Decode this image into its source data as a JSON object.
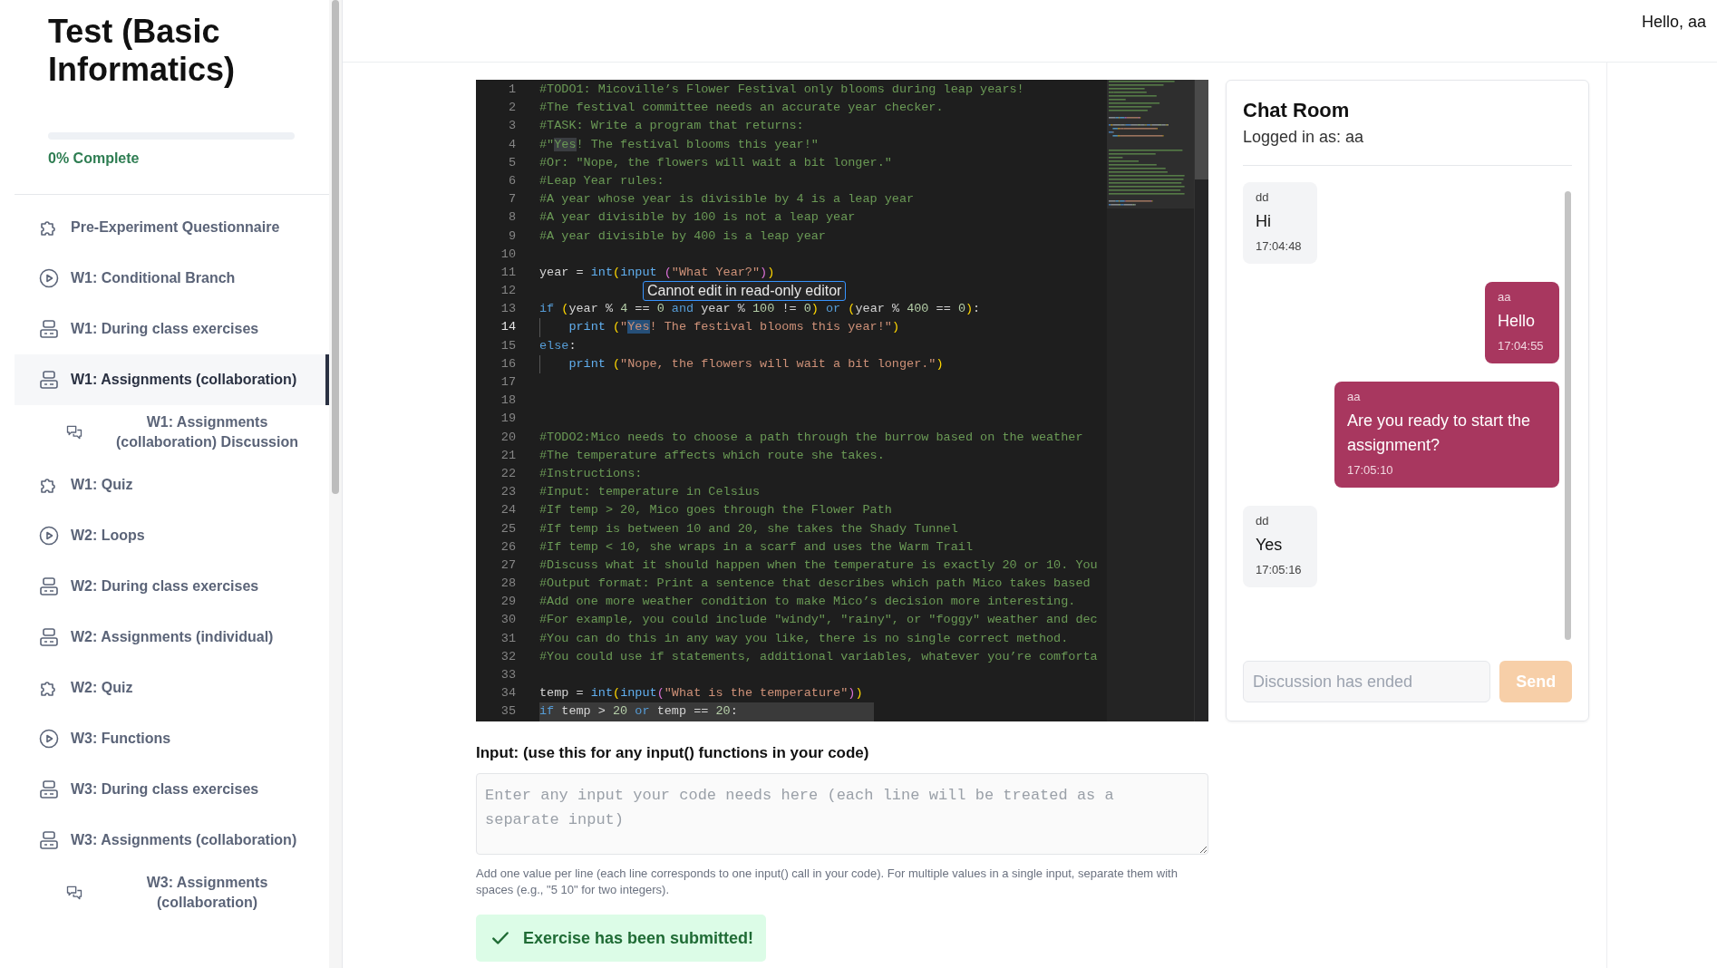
{
  "sidebar": {
    "course_title": "Test (Basic Informatics)",
    "progress": {
      "level": 0,
      "label": "0% Complete"
    },
    "items": [
      {
        "label": "Pre-Experiment Questionnaire",
        "kind": "quiz",
        "selected": false,
        "sub": false
      },
      {
        "label": "W1: Conditional Branch",
        "kind": "video",
        "selected": false,
        "sub": false
      },
      {
        "label": "W1: During class exercises",
        "kind": "exercise",
        "selected": false,
        "sub": false
      },
      {
        "label": "W1: Assignments (collaboration)",
        "kind": "exercise",
        "selected": true,
        "sub": false
      },
      {
        "label": "W1: Assignments (collaboration) Discussion",
        "kind": "discussion",
        "selected": false,
        "sub": true
      },
      {
        "label": "W1: Quiz",
        "kind": "quiz",
        "selected": false,
        "sub": false
      },
      {
        "label": "W2: Loops",
        "kind": "video",
        "selected": false,
        "sub": false
      },
      {
        "label": "W2: During class exercises",
        "kind": "exercise",
        "selected": false,
        "sub": false
      },
      {
        "label": "W2: Assignments (individual)",
        "kind": "exercise",
        "selected": false,
        "sub": false
      },
      {
        "label": "W2: Quiz",
        "kind": "quiz",
        "selected": false,
        "sub": false
      },
      {
        "label": "W3: Functions",
        "kind": "video",
        "selected": false,
        "sub": false
      },
      {
        "label": "W3: During class exercises",
        "kind": "exercise",
        "selected": false,
        "sub": false
      },
      {
        "label": "W3: Assignments (collaboration)",
        "kind": "exercise",
        "selected": false,
        "sub": false
      },
      {
        "label": "W3: Assignments (collaboration)",
        "kind": "discussion",
        "selected": false,
        "sub": true
      }
    ]
  },
  "header": {
    "greeting": "Hello, aa"
  },
  "editor": {
    "lines": [
      {
        "n": "1",
        "current": false,
        "shaded": false,
        "indent": false,
        "segs": [
          {
            "kind": "comment",
            "text": "#TODO1: Micoville’s Flower Festival only blooms during leap years!"
          }
        ]
      },
      {
        "n": "2",
        "current": false,
        "shaded": false,
        "indent": false,
        "segs": [
          {
            "kind": "comment",
            "text": "#The festival committee needs an accurate year checker."
          }
        ]
      },
      {
        "n": "3",
        "current": false,
        "shaded": false,
        "indent": false,
        "segs": [
          {
            "kind": "comment",
            "text": "#TASK: Write a program that returns:"
          }
        ]
      },
      {
        "n": "4",
        "current": false,
        "shaded": false,
        "indent": false,
        "segs": [
          {
            "kind": "comment",
            "text": "#\""
          },
          {
            "kind": "match",
            "text": "Yes"
          },
          {
            "kind": "comment",
            "text": "! The festival blooms this year!\""
          }
        ]
      },
      {
        "n": "5",
        "current": false,
        "shaded": false,
        "indent": false,
        "segs": [
          {
            "kind": "comment",
            "text": "#Or: \"Nope, the flowers will wait a bit longer.\""
          }
        ]
      },
      {
        "n": "6",
        "current": false,
        "shaded": false,
        "indent": false,
        "segs": [
          {
            "kind": "comment",
            "text": "#Leap Year rules:"
          }
        ]
      },
      {
        "n": "7",
        "current": false,
        "shaded": false,
        "indent": false,
        "segs": [
          {
            "kind": "comment",
            "text": "#A year whose year is divisible by 4 is a leap year"
          }
        ]
      },
      {
        "n": "8",
        "current": false,
        "shaded": false,
        "indent": false,
        "segs": [
          {
            "kind": "comment",
            "text": "#A year divisible by 100 is not a leap year"
          }
        ]
      },
      {
        "n": "9",
        "current": false,
        "shaded": false,
        "indent": false,
        "segs": [
          {
            "kind": "comment",
            "text": "#A year divisible by 400 is a leap year"
          }
        ]
      },
      {
        "n": "10",
        "current": false,
        "shaded": false,
        "indent": false
      },
      {
        "n": "11",
        "current": false,
        "shaded": false,
        "indent": false,
        "segs": [
          {
            "kind": "plain",
            "text": "year = "
          },
          {
            "kind": "func",
            "text": "int"
          },
          {
            "kind": "paren1",
            "text": "("
          },
          {
            "kind": "func",
            "text": "input"
          },
          {
            "kind": "paren2",
            "text": " ("
          },
          {
            "kind": "string",
            "text": "\"What Year?\""
          },
          {
            "kind": "paren2",
            "text": ")"
          },
          {
            "kind": "paren1",
            "text": ")"
          }
        ]
      },
      {
        "n": "12",
        "current": false,
        "shaded": false,
        "indent": false,
        "tooltip": "Cannot edit in read-only editor"
      },
      {
        "n": "13",
        "current": false,
        "shaded": false,
        "indent": false,
        "segs": [
          {
            "kind": "keyword",
            "text": "if"
          },
          {
            "kind": "paren1",
            "text": " ("
          },
          {
            "kind": "plain",
            "text": "year % "
          },
          {
            "kind": "number",
            "text": "4"
          },
          {
            "kind": "plain",
            "text": " == "
          },
          {
            "kind": "number",
            "text": "0"
          },
          {
            "kind": "keyword",
            "text": " and "
          },
          {
            "kind": "plain",
            "text": "year % "
          },
          {
            "kind": "number",
            "text": "100"
          },
          {
            "kind": "plain",
            "text": " != "
          },
          {
            "kind": "number",
            "text": "0"
          },
          {
            "kind": "paren1",
            "text": ")"
          },
          {
            "kind": "keyword",
            "text": " or "
          },
          {
            "kind": "paren1",
            "text": "("
          },
          {
            "kind": "plain",
            "text": "year % "
          },
          {
            "kind": "number",
            "text": "400"
          },
          {
            "kind": "plain",
            "text": " == "
          },
          {
            "kind": "number",
            "text": "0"
          },
          {
            "kind": "paren1",
            "text": ")"
          },
          {
            "kind": "plain",
            "text": ":"
          }
        ]
      },
      {
        "n": "14",
        "current": true,
        "shaded": false,
        "indent": true,
        "segs": [
          {
            "kind": "func",
            "text": "print"
          },
          {
            "kind": "paren1",
            "text": " ("
          },
          {
            "kind": "string",
            "text": "\""
          },
          {
            "kind": "selection",
            "text": "Yes"
          },
          {
            "kind": "string",
            "text": "! The festival blooms this year!\""
          },
          {
            "kind": "paren1",
            "text": ")"
          }
        ]
      },
      {
        "n": "15",
        "current": false,
        "shaded": false,
        "indent": false,
        "segs": [
          {
            "kind": "keyword",
            "text": "else"
          },
          {
            "kind": "plain",
            "text": ":"
          }
        ]
      },
      {
        "n": "16",
        "current": false,
        "shaded": false,
        "indent": true,
        "segs": [
          {
            "kind": "func",
            "text": "print"
          },
          {
            "kind": "paren1",
            "text": " ("
          },
          {
            "kind": "string",
            "text": "\"Nope, the flowers will wait a bit longer.\""
          },
          {
            "kind": "paren1",
            "text": ")"
          }
        ]
      },
      {
        "n": "17",
        "current": false,
        "shaded": false,
        "indent": false
      },
      {
        "n": "18",
        "current": false,
        "shaded": false,
        "indent": false
      },
      {
        "n": "19",
        "current": false,
        "shaded": false,
        "indent": false
      },
      {
        "n": "20",
        "current": false,
        "shaded": false,
        "indent": false,
        "segs": [
          {
            "kind": "comment",
            "text": "#TODO2:Mico needs to choose a path through the burrow based on the weather"
          }
        ]
      },
      {
        "n": "21",
        "current": false,
        "shaded": false,
        "indent": false,
        "segs": [
          {
            "kind": "comment",
            "text": "#The temperature affects which route she takes."
          }
        ]
      },
      {
        "n": "22",
        "current": false,
        "shaded": false,
        "indent": false,
        "segs": [
          {
            "kind": "comment",
            "text": "#Instructions:"
          }
        ]
      },
      {
        "n": "23",
        "current": false,
        "shaded": false,
        "indent": false,
        "segs": [
          {
            "kind": "comment",
            "text": "#Input: temperature in Celsius"
          }
        ]
      },
      {
        "n": "24",
        "current": false,
        "shaded": false,
        "indent": false,
        "segs": [
          {
            "kind": "comment",
            "text": "#If temp > 20, Mico goes through the Flower Path"
          }
        ]
      },
      {
        "n": "25",
        "current": false,
        "shaded": false,
        "indent": false,
        "segs": [
          {
            "kind": "comment",
            "text": "#If temp is between 10 and 20, she takes the Shady Tunnel"
          }
        ]
      },
      {
        "n": "26",
        "current": false,
        "shaded": false,
        "indent": false,
        "segs": [
          {
            "kind": "comment",
            "text": "#If temp < 10, she wraps in a scarf and uses the Warm Trail"
          }
        ]
      },
      {
        "n": "27",
        "current": false,
        "shaded": false,
        "indent": false,
        "segs": [
          {
            "kind": "comment",
            "text": "#Discuss what it should happen when the temperature is exactly 20 or 10. You"
          }
        ]
      },
      {
        "n": "28",
        "current": false,
        "shaded": false,
        "indent": false,
        "segs": [
          {
            "kind": "comment",
            "text": "#Output format: Print a sentence that describes which path Mico takes based"
          }
        ]
      },
      {
        "n": "29",
        "current": false,
        "shaded": false,
        "indent": false,
        "segs": [
          {
            "kind": "comment",
            "text": "#Add one more weather condition to make Mico’s decision more interesting."
          }
        ]
      },
      {
        "n": "30",
        "current": false,
        "shaded": false,
        "indent": false,
        "segs": [
          {
            "kind": "comment",
            "text": "#For example, you could include \"windy\", \"rainy\", or \"foggy\" weather and dec"
          }
        ]
      },
      {
        "n": "31",
        "current": false,
        "shaded": false,
        "indent": false,
        "segs": [
          {
            "kind": "comment",
            "text": "#You can do this in any way you like, there is no single correct method."
          }
        ]
      },
      {
        "n": "32",
        "current": false,
        "shaded": false,
        "indent": false,
        "segs": [
          {
            "kind": "comment",
            "text": "#You could use if statements, additional variables, whatever you’re comforta"
          }
        ]
      },
      {
        "n": "33",
        "current": false,
        "shaded": false,
        "indent": false
      },
      {
        "n": "34",
        "current": false,
        "shaded": false,
        "indent": false,
        "segs": [
          {
            "kind": "plain",
            "text": "temp = "
          },
          {
            "kind": "func",
            "text": "int"
          },
          {
            "kind": "paren1",
            "text": "("
          },
          {
            "kind": "func",
            "text": "input"
          },
          {
            "kind": "paren2",
            "text": "("
          },
          {
            "kind": "string",
            "text": "\"What is the temperature\""
          },
          {
            "kind": "paren2",
            "text": ")"
          },
          {
            "kind": "paren1",
            "text": ")"
          }
        ]
      },
      {
        "n": "35",
        "current": false,
        "shaded": true,
        "indent": false,
        "segs": [
          {
            "kind": "keyword",
            "text": "if"
          },
          {
            "kind": "plain",
            "text": " temp > "
          },
          {
            "kind": "number",
            "text": "20"
          },
          {
            "kind": "keyword",
            "text": " or"
          },
          {
            "kind": "plain",
            "text": " temp == "
          },
          {
            "kind": "number",
            "text": "20"
          },
          {
            "kind": "plain",
            "text": ":"
          }
        ]
      }
    ]
  },
  "input_section": {
    "label": "Input: (use this for any input() functions in your code)",
    "placeholder": "Enter any input your code needs here (each line will be treated as a separate input)",
    "help": "Add one value per line (each line corresponds to one input() call in your code). For multiple values in a single input, separate them with spaces (e.g., \"5 10\" for two integers).",
    "status": "Exercise has been submitted!"
  },
  "chat": {
    "title": "Chat Room",
    "logged_in": "Logged in as: aa",
    "messages": [
      {
        "sender": "dd",
        "text": "Hi",
        "time": "17:04:48",
        "own": false
      },
      {
        "sender": "aa",
        "text": "Hello",
        "time": "17:04:55",
        "own": true
      },
      {
        "sender": "aa",
        "text": "Are you ready to start the assignment?",
        "time": "17:05:10",
        "own": true
      },
      {
        "sender": "dd",
        "text": "Yes",
        "time": "17:05:16",
        "own": false
      }
    ],
    "input": {
      "placeholder": "Discussion has ended",
      "disabled": true
    },
    "send": {
      "label": "Send",
      "disabled": true
    }
  }
}
